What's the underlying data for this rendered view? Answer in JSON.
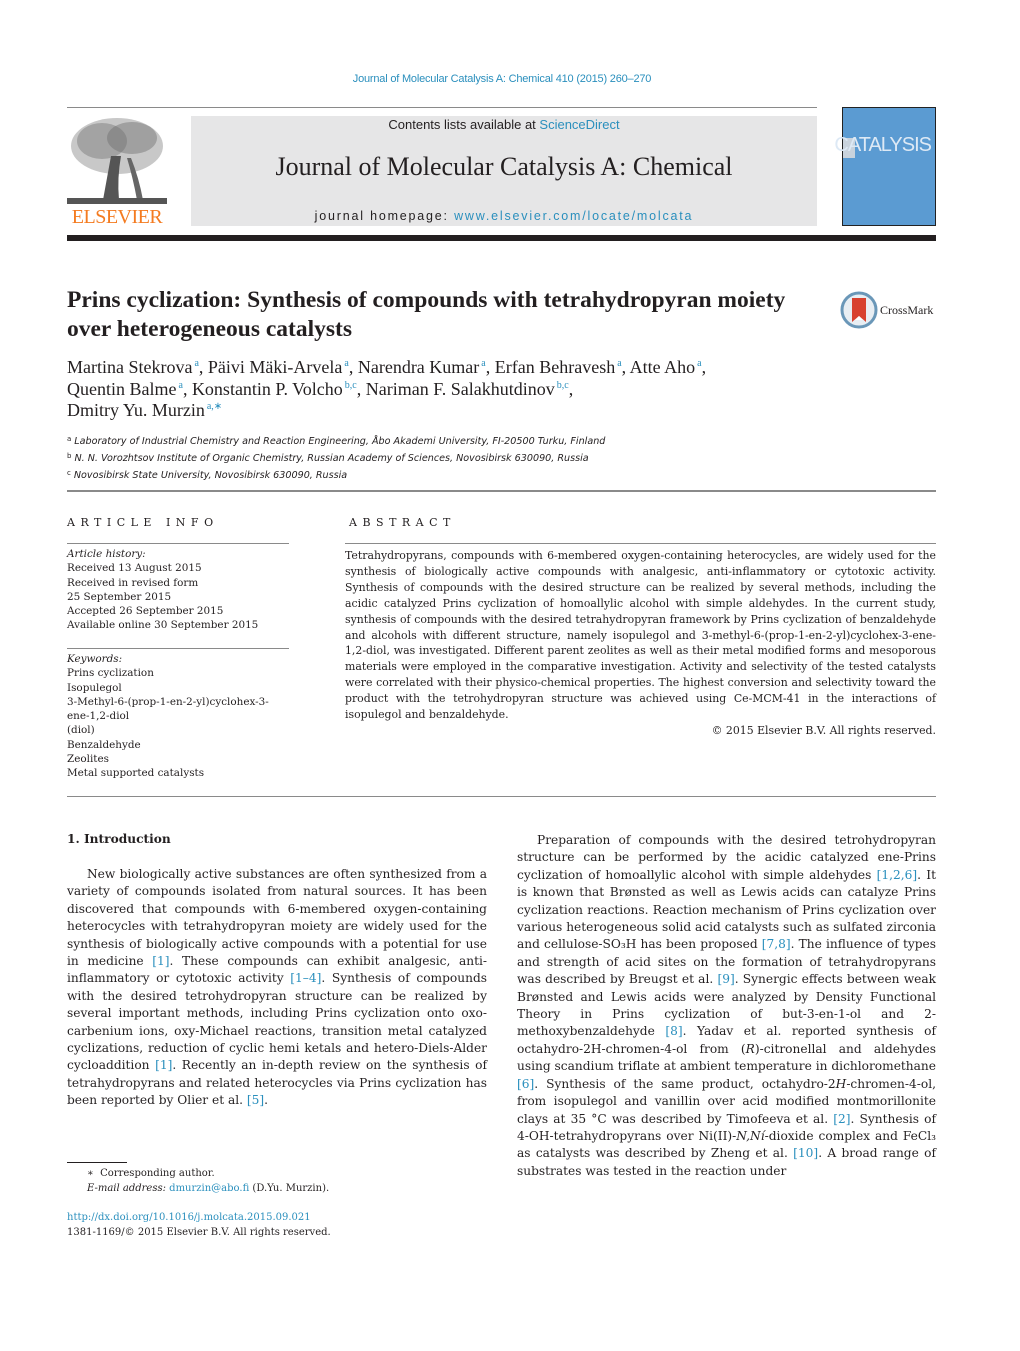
{
  "journal_citation": "Journal of Molecular Catalysis A: Chemical 410 (2015) 260–270",
  "header": {
    "publisher": "ELSEVIER",
    "contents_prefix": "Contents lists available at ",
    "contents_link": "ScienceDirect",
    "journal_title": "Journal of Molecular Catalysis A: Chemical",
    "homepage_prefix": "journal homepage: ",
    "homepage_link": "www.elsevier.com/locate/molcata",
    "cover_title": "CATALYSIS",
    "cover_letter": "C"
  },
  "crossmark_label": "CrossMark",
  "title": "Prins cyclization: Synthesis of compounds with tetrahydropyran moiety over heterogeneous catalysts",
  "authors": [
    {
      "name": "Martina Stekrova",
      "aff": "a",
      "sep": ", "
    },
    {
      "name": "Päivi Mäki-Arvela",
      "aff": "a",
      "sep": ", "
    },
    {
      "name": "Narendra Kumar",
      "aff": "a",
      "sep": ", "
    },
    {
      "name": "Erfan Behravesh",
      "aff": "a",
      "sep": ", "
    },
    {
      "name": "Atte Aho",
      "aff": "a",
      "sep": ","
    },
    {
      "name": "Quentin Balme",
      "aff": "a",
      "sep": ", "
    },
    {
      "name": "Konstantin P. Volcho",
      "aff": "b,c",
      "sep": ", "
    },
    {
      "name": "Nariman F. Salakhutdinov",
      "aff": "b,c",
      "sep": ","
    },
    {
      "name": "Dmitry Yu. Murzin",
      "aff": "a,∗",
      "sep": ""
    }
  ],
  "affiliations": [
    {
      "key": "a",
      "text": "Laboratory of Industrial Chemistry and Reaction Engineering, Åbo Akademi University, FI-20500 Turku, Finland"
    },
    {
      "key": "b",
      "text": "N. N. Vorozhtsov Institute of Organic Chemistry, Russian Academy of Sciences, Novosibirsk 630090, Russia"
    },
    {
      "key": "c",
      "text": "Novosibirsk State University, Novosibirsk 630090, Russia"
    }
  ],
  "article_info": {
    "heading": "ARTICLE INFO",
    "history_label": "Article history:",
    "history": [
      "Received 13 August 2015",
      "Received in revised form",
      "25 September 2015",
      "Accepted 26 September 2015",
      "Available online 30 September 2015"
    ],
    "keywords_label": "Keywords:",
    "keywords": [
      "Prins cyclization",
      "Isopulegol",
      "3-Methyl-6-(prop-1-en-2-yl)cyclohex-3-ene-1,2-diol",
      "(diol)",
      "Benzaldehyde",
      "Zeolites",
      "Metal supported catalysts"
    ]
  },
  "abstract": {
    "heading": "ABSTRACT",
    "text": "Tetrahydropyrans, compounds with 6-membered oxygen-containing heterocycles, are widely used for the synthesis of biologically active compounds with analgesic, anti-inflammatory or cytotoxic activity. Synthesis of compounds with the desired structure can be realized by several methods, including the acidic catalyzed Prins cyclization of homoallylic alcohol with simple aldehydes. In the current study, synthesis of compounds with the desired tetrahydropyran framework by Prins cyclization of benzaldehyde and alcohols with different structure, namely isopulegol and 3-methyl-6-(prop-1-en-2-yl)cyclohex-3-ene-1,2-diol, was investigated. Different parent zeolites as well as their metal modified forms and mesoporous materials were employed in the comparative investigation. Activity and selectivity of the tested catalysts were correlated with their physico-chemical properties. The highest conversion and selectivity toward the product with the tetrohydropyran structure was achieved using Ce-MCM-41 in the interactions of isopulegol and benzaldehyde.",
    "copyright": "© 2015 Elsevier B.V. All rights reserved."
  },
  "section1": {
    "heading": "1.  Introduction",
    "left_paragraph": [
      {
        "t": "New biologically active substances are often synthesized from a variety of compounds isolated from natural sources. It has been discovered that compounds with 6-membered oxygen-containing heterocycles with tetrahydropyran moiety are widely used for the synthesis of biologically active compounds with a potential for use in medicine "
      },
      {
        "ref": "[1]"
      },
      {
        "t": ". These compounds can exhibit analgesic, anti-inflammatory or cytotoxic activity "
      },
      {
        "ref": "[1–4]"
      },
      {
        "t": ". Synthesis of compounds with the desired tetrohydropyran structure can be realized by several important methods, including Prins cyclization onto oxo-carbenium ions, oxy-Michael reactions, transition metal catalyzed cyclizations, reduction of cyclic hemi ketals and hetero-Diels-Alder cycloaddition "
      },
      {
        "ref": "[1]"
      },
      {
        "t": ". Recently an in-depth review on the synthesis of tetrahydropyrans and related heterocycles via Prins cyclization has been reported by Olier et al. "
      },
      {
        "ref": "[5]"
      },
      {
        "t": "."
      }
    ],
    "right_paragraph": [
      {
        "t": "Preparation of compounds with the desired tetrohydropyran structure can be performed by the acidic catalyzed ene-Prins cyclization of homoallylic alcohol with simple aldehydes "
      },
      {
        "ref": "[1,2,6]"
      },
      {
        "t": ". It is known that Brønsted as well as Lewis acids can catalyze Prins cyclization reactions. Reaction mechanism of Prins cyclization over various heterogeneous solid acid catalysts such as sulfated zirconia and cellulose-SO₃H has been proposed "
      },
      {
        "ref": "[7,8]"
      },
      {
        "t": ". The influence of types and strength of acid sites on the formation of tetrahydropyrans was described by Breugst et al. "
      },
      {
        "ref": "[9]"
      },
      {
        "t": ". Synergic effects between weak Brønsted and Lewis acids were analyzed by Density Functional Theory in Prins cyclization of but-3-en-1-ol and 2-methoxybenzaldehyde "
      },
      {
        "ref": "[8]"
      },
      {
        "t": ". Yadav et al. reported synthesis of octahydro-2H-chromen-4-ol from ("
      },
      {
        "i": "R"
      },
      {
        "t": ")-citronellal and aldehydes using scandium triflate at ambient temperature in dichloromethane "
      },
      {
        "ref": "[6]"
      },
      {
        "t": ". Synthesis of the same product, octahydro-2"
      },
      {
        "i": "H"
      },
      {
        "t": "-chromen-4-ol, from isopulegol and vanillin over acid modified montmorillonite clays at 35 °C was described by Timofeeva et al. "
      },
      {
        "ref": "[2]"
      },
      {
        "t": ". Synthesis of 4-OH-tetrahydropyrans over Ni(II)-"
      },
      {
        "i": "N,Ní"
      },
      {
        "t": "-dioxide complex and FeCl₃ as catalysts was described by Zheng et al. "
      },
      {
        "ref": "[10]"
      },
      {
        "t": ". A broad range of substrates was tested in the reaction under"
      }
    ]
  },
  "footnote": {
    "star": "∗",
    "corresponding": "Corresponding author.",
    "email_label": "E-mail address: ",
    "email": "dmurzin@abo.fi",
    "email_suffix": " (D.Yu. Murzin)."
  },
  "doi": "http://dx.doi.org/10.1016/j.molcata.2015.09.021",
  "issn_line": "1381-1169/© 2015 Elsevier B.V. All rights reserved.",
  "colors": {
    "link": "#2a8fbd",
    "elsevier_orange": "#f47b20",
    "banner_gray": "#e6e6e7",
    "cover_blue": "#5b9bd2"
  }
}
